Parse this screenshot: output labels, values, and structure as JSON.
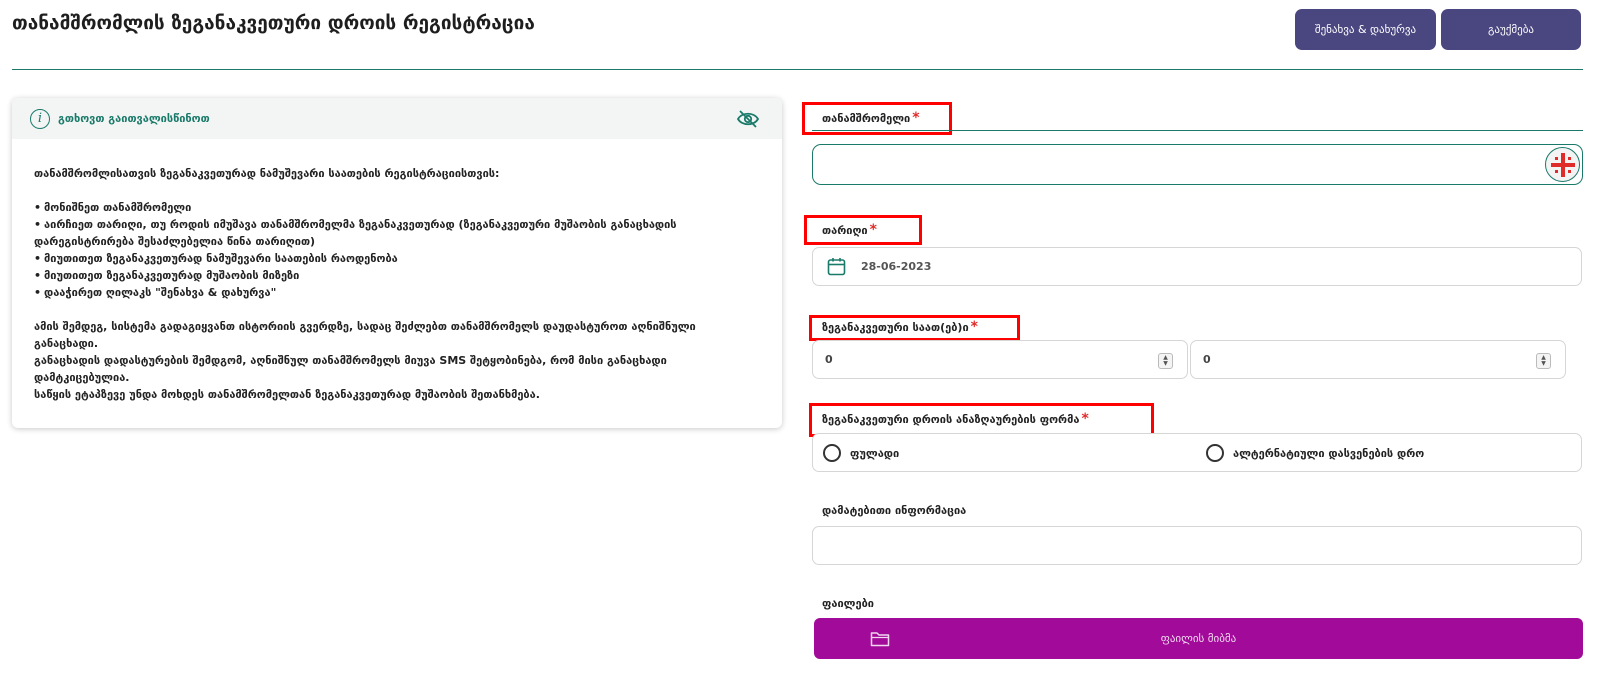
{
  "header": {
    "title": "თანამშრომლის ზეგანაკვეთური დროის რეგისტრაცია",
    "save_label": "შენახვა & დახურვა",
    "cancel_label": "გაუქმება"
  },
  "info": {
    "title": "გთხოვთ გაითვალისწინოთ",
    "intro": "თანამშრომლისათვის ზეგანაკვეთურად ნამუშევარი საათების რეგისტრაციისთვის:",
    "bullets": [
      "მონიშნეთ თანამშრომელი",
      "აირჩიეთ თარიღი, თუ როდის იმუშავა თანამშრომელმა ზეგანაკვეთურად (ზეგანაკვეთური მუშაობის განაცხადის დარეგისტრირება შესაძლებელია წინა თარიღით)",
      "მიუთითეთ ზეგანაკვეთურად ნამუშევარი საათების რაოდენობა",
      "მიუთითეთ ზეგანაკვეთურად მუშაობის მიზეზი",
      "დააჭირეთ ღილაკს \"შენახვა & დახურვა\""
    ],
    "paragraphs": [
      "ამის შემდეგ, სისტემა გადაგიყვანთ ისტორიის გვერდზე, სადაც შეძლებთ თანამშრომელს დაუდასტუროთ აღნიშნული განაცხადი.",
      "განაცხადის დადასტურების შემდგომ, აღნიშნულ თანამშრომელს მიუვა SMS შეტყობინება, რომ მისი განაცხადი დამტკიცებულია.",
      "საწყის ეტაპზევე უნდა მოხდეს თანამშრომელთან ზეგანაკვეთურად მუშაობის შეთანხმება."
    ]
  },
  "form": {
    "employee_label": "თანამშრომელი",
    "date_label": "თარიღი",
    "date_value": "28-06-2023",
    "hours_label": "ზეგანაკვეთური საათ(ებ)ი",
    "hours_value_1": "0",
    "hours_value_2": "0",
    "payment_label": "ზეგანაკვეთური დროის ანაზღაურების ფორმა",
    "payment_options": [
      "ფულადი",
      "ალტერნატიული დასვენების დრო"
    ],
    "extra_label": "დამატებითი ინფორმაცია",
    "files_label": "ფაილები",
    "upload_label": "ფაილის მიბმა",
    "required_mark": "*"
  },
  "colors": {
    "primary": "#4a4680",
    "accent": "#1a7a6a",
    "upload": "#a20a9a",
    "required": "#e02b2b",
    "highlight": "#ff0000"
  }
}
